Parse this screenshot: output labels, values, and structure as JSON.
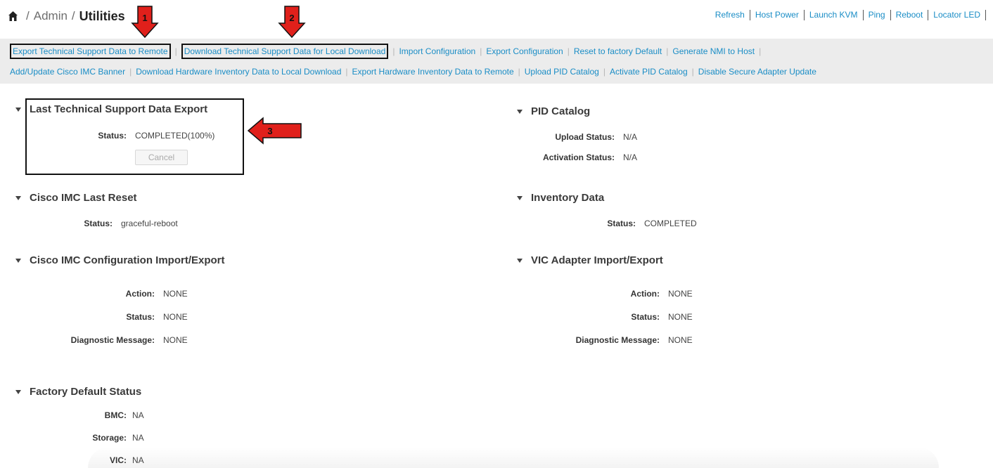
{
  "breadcrumb": {
    "part1": "Admin",
    "part2": "Utilities",
    "separator": "/"
  },
  "top_actions": [
    "Refresh",
    "Host Power",
    "Launch KVM",
    "Ping",
    "Reboot",
    "Locator LED"
  ],
  "toolbar": {
    "row1": [
      "Export Technical Support Data to Remote",
      "Download Technical Support Data for Local Download",
      "Import Configuration",
      "Export Configuration",
      "Reset to factory Default",
      "Generate NMI to Host"
    ],
    "row2": [
      "Add/Update Cisco IMC Banner",
      "Download Hardware Inventory Data to Local Download",
      "Export Hardware Inventory Data to Remote",
      "Upload PID Catalog",
      "Activate PID Catalog",
      "Disable Secure Adapter Update"
    ]
  },
  "sections": {
    "last_export": {
      "title": "Last Technical Support Data Export",
      "status_label": "Status:",
      "status_value": "COMPLETED(100%)",
      "cancel": "Cancel"
    },
    "last_reset": {
      "title": "Cisco IMC Last Reset",
      "status_label": "Status:",
      "status_value": "graceful-reboot"
    },
    "config": {
      "title": "Cisco IMC Configuration Import/Export",
      "action_label": "Action:",
      "action_value": "NONE",
      "status_label": "Status:",
      "status_value": "NONE",
      "diag_label": "Diagnostic Message:",
      "diag_value": "NONE"
    },
    "factory": {
      "title": "Factory Default Status",
      "bmc_label": "BMC:",
      "bmc_value": "NA",
      "storage_label": "Storage:",
      "storage_value": "NA",
      "vic_label": "VIC:",
      "vic_value": "NA"
    },
    "pid": {
      "title": "PID Catalog",
      "upload_label": "Upload Status:",
      "upload_value": "N/A",
      "activation_label": "Activation Status:",
      "activation_value": "N/A"
    },
    "inventory": {
      "title": "Inventory Data",
      "status_label": "Status:",
      "status_value": "COMPLETED"
    },
    "vic": {
      "title": "VIC Adapter Import/Export",
      "action_label": "Action:",
      "action_value": "NONE",
      "status_label": "Status:",
      "status_value": "NONE",
      "diag_label": "Diagnostic Message:",
      "diag_value": "NONE"
    }
  },
  "annotations": [
    "1",
    "2",
    "3"
  ],
  "colors": {
    "link": "#1a8dc6",
    "arrow": "#e0201b",
    "toolbar_bg": "#ececec"
  }
}
